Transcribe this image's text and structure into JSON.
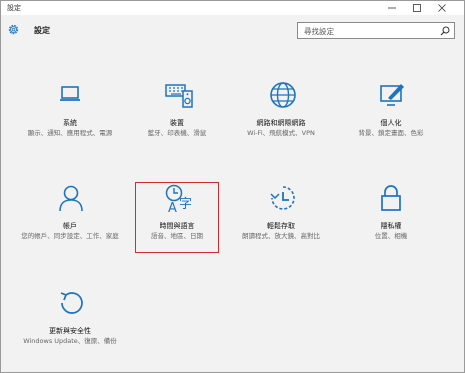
{
  "window": {
    "title": "設定"
  },
  "header": {
    "title": "設定",
    "icon": "gear-icon"
  },
  "search": {
    "placeholder": "尋找設定"
  },
  "accent_color": "#1e73be",
  "tiles": [
    {
      "id": "system",
      "name": "系統",
      "desc": "顯示、通知、應用程式、電源",
      "icon": "laptop-icon"
    },
    {
      "id": "devices",
      "name": "裝置",
      "desc": "藍牙、印表機、滑鼠",
      "icon": "keyboard-speaker-icon"
    },
    {
      "id": "network",
      "name": "網路和網際網路",
      "desc": "Wi-Fi、飛航模式、VPN",
      "icon": "globe-icon"
    },
    {
      "id": "personalization",
      "name": "個人化",
      "desc": "背景、鎖定畫面、色彩",
      "icon": "paint-monitor-icon"
    },
    {
      "id": "accounts",
      "name": "帳戶",
      "desc": "您的帳戶、同步設定、工作、家庭",
      "icon": "person-icon"
    },
    {
      "id": "time-language",
      "name": "時間與語言",
      "desc": "語音、地區、日期",
      "icon": "clock-language-icon"
    },
    {
      "id": "ease-of-access",
      "name": "輕鬆存取",
      "desc": "朗讀程式、放大鏡、高對比",
      "icon": "accessibility-icon"
    },
    {
      "id": "privacy",
      "name": "隱私權",
      "desc": "位置、相機",
      "icon": "padlock-icon"
    },
    {
      "id": "update-security",
      "name": "更新與安全性",
      "desc": "Windows Update、復原、備份",
      "icon": "refresh-icon"
    }
  ]
}
